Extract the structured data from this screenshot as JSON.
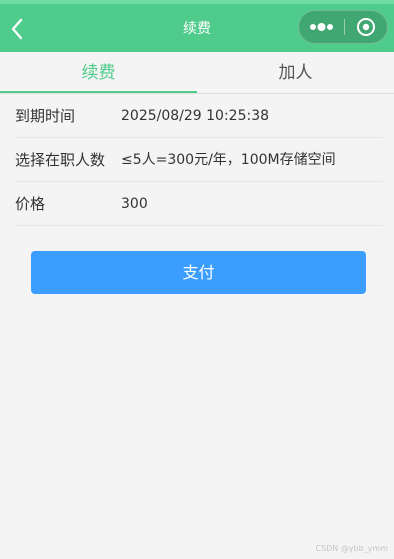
{
  "header": {
    "title": "续费",
    "background_color": "#4fcb8b"
  },
  "icons": {
    "back": "chevron-left-icon",
    "more": "more-dots-icon",
    "close": "target-circle-icon"
  },
  "tabs": [
    {
      "label": "续费",
      "active": true
    },
    {
      "label": "加人",
      "active": false
    }
  ],
  "rows": [
    {
      "label": "到期时间",
      "value": "2025/08/29 10:25:38"
    },
    {
      "label": "选择在职人数",
      "value": "≤5人=300元/年，100M存储空间"
    },
    {
      "label": "价格",
      "value": "300"
    }
  ],
  "pay_button": {
    "label": "支付",
    "color": "#3b9eff"
  },
  "watermark": "CSDN @ybb_ymm",
  "accent_color": "#4fcb8b"
}
